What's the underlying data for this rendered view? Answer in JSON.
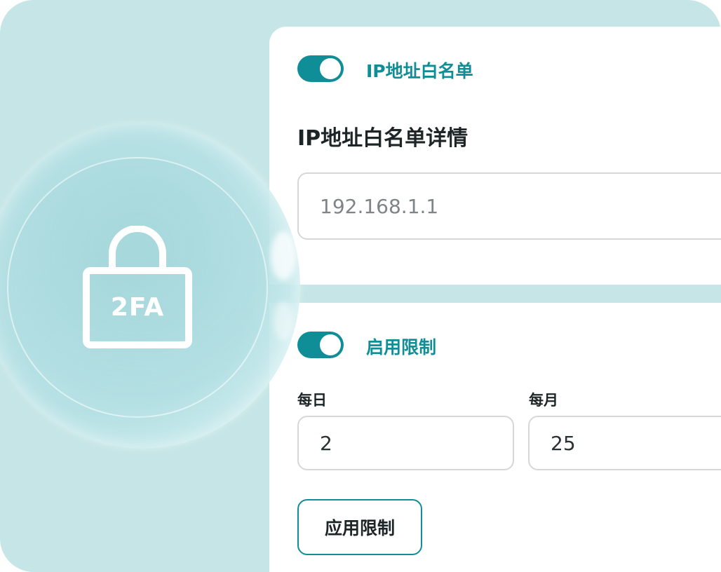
{
  "whitelist": {
    "toggle_label": "IP地址白名单",
    "enabled": true,
    "details_title": "IP地址白名单详情",
    "ip_input": {
      "placeholder": "192.168.1.1",
      "value": ""
    }
  },
  "limits": {
    "toggle_label": "启用限制",
    "enabled": true,
    "daily": {
      "label": "每日",
      "value": "2"
    },
    "monthly": {
      "label": "每月",
      "value": "25"
    },
    "apply_button": "应用限制"
  },
  "badge": {
    "text": "2FA",
    "icon": "lock-icon"
  },
  "colors": {
    "accent": "#0f8e97",
    "background": "#c5e5e6",
    "panel": "#ffffff",
    "text_dark": "#1e2526"
  }
}
